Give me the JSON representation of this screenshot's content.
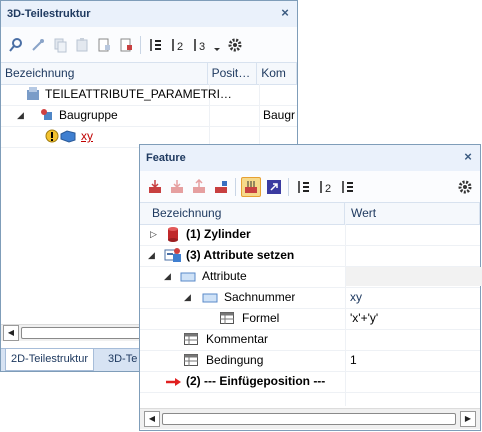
{
  "back_panel": {
    "title": "3D-Teilestruktur",
    "close_label": "×",
    "columns": [
      "Bezeichnung",
      "Posit…",
      "Kom"
    ],
    "rows": [
      {
        "name": "TEILEATTRIBUTE_PARAMETRI…",
        "kommentar": ""
      },
      {
        "name": "Baugruppe",
        "kommentar": "Baugr"
      },
      {
        "name": "xy",
        "kommentar": ""
      }
    ],
    "tabs": [
      "2D-Teilestruktur",
      "3D-Te"
    ]
  },
  "front_panel": {
    "title": "Feature",
    "close_label": "×",
    "columns": [
      "Bezeichnung",
      "Wert"
    ],
    "rows": [
      {
        "label": "(1) Zylinder",
        "value": ""
      },
      {
        "label": "(3) Attribute setzen",
        "value": ""
      },
      {
        "label": "Attribute",
        "value": ""
      },
      {
        "label": "Sachnummer",
        "value": "xy"
      },
      {
        "label": "Formel",
        "value": "'x'+'y'"
      },
      {
        "label": "Kommentar",
        "value": ""
      },
      {
        "label": "Bedingung",
        "value": "1"
      },
      {
        "label": "(2) --- Einfügeposition ---",
        "value": ""
      }
    ]
  },
  "colors": {
    "title_bg": "#eaf1fb",
    "title_text": "#1f3a60",
    "border": "#7f9db9",
    "accent_orange": "#e7a032",
    "error_red": "#c00000"
  }
}
